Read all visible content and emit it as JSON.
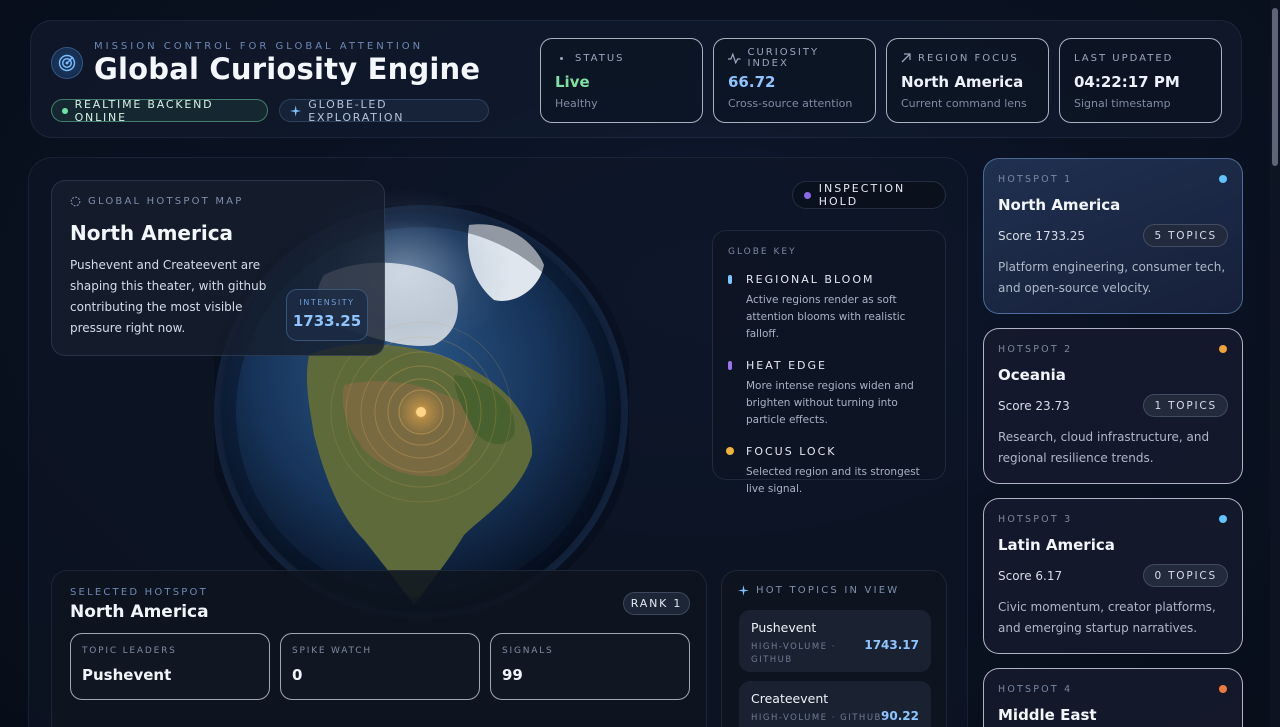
{
  "header": {
    "eyebrow": "MISSION CONTROL FOR GLOBAL ATTENTION",
    "title": "Global Curiosity Engine",
    "pill_online": "REALTIME BACKEND ONLINE",
    "pill_explore": "GLOBE-LED EXPLORATION"
  },
  "stats": [
    {
      "label": "STATUS",
      "value": "Live",
      "sub": "Healthy",
      "icon": "dot-icon",
      "value_color": "#7ee0a4"
    },
    {
      "label": "CURIOSITY INDEX",
      "value": "66.72",
      "sub": "Cross-source attention",
      "icon": "pulse-icon",
      "value_color": "#8ec4ff"
    },
    {
      "label": "REGION FOCUS",
      "value": "North America",
      "sub": "Current command lens",
      "icon": "arrow-up-right-icon",
      "value_color": "#eef3fb"
    },
    {
      "label": "LAST UPDATED",
      "value": "04:22:17 PM",
      "sub": "Signal timestamp",
      "icon": "",
      "value_color": "#eef3fb"
    }
  ],
  "map_card": {
    "eyebrow": "GLOBAL HOTSPOT MAP",
    "title": "North America",
    "description": "Pushevent and Createevent are shaping this theater, with github contributing the most visible pressure right now.",
    "intensity_label": "INTENSITY",
    "intensity_value": "1733.25"
  },
  "inspection_pill": "INSPECTION HOLD",
  "globe_key": {
    "heading": "GLOBE KEY",
    "items": [
      {
        "title": "REGIONAL BLOOM",
        "desc": "Active regions render as soft attention blooms with realistic falloff.",
        "color": "#7cc6ff"
      },
      {
        "title": "HEAT EDGE",
        "desc": "More intense regions widen and brighten without turning into particle effects.",
        "color": "#9a74f0"
      },
      {
        "title": "FOCUS LOCK",
        "desc": "Selected region and its strongest live signal.",
        "color": "#f0b43c"
      }
    ]
  },
  "selected": {
    "eyebrow": "SELECTED HOTSPOT",
    "title": "North America",
    "rank": "RANK 1",
    "metrics": [
      {
        "label": "TOPIC LEADERS",
        "value": "Pushevent"
      },
      {
        "label": "SPIKE WATCH",
        "value": "0"
      },
      {
        "label": "SIGNALS",
        "value": "99"
      }
    ]
  },
  "hot_topics": {
    "heading": "HOT TOPICS IN VIEW",
    "items": [
      {
        "name": "Pushevent",
        "meta": "HIGH-VOLUME · GITHUB",
        "score": "1743.17"
      },
      {
        "name": "Createevent",
        "meta": "HIGH-VOLUME · GITHUB",
        "score": "90.22"
      }
    ]
  },
  "hotspots": [
    {
      "eyebrow": "HOTSPOT 1",
      "title": "North America",
      "score": "Score 1733.25",
      "topics": "5 TOPICS",
      "desc": "Platform engineering, consumer tech, and open-source velocity.",
      "color": "#5fc4ff"
    },
    {
      "eyebrow": "HOTSPOT 2",
      "title": "Oceania",
      "score": "Score 23.73",
      "topics": "1 TOPICS",
      "desc": "Research, cloud infrastructure, and regional resilience trends.",
      "color": "#f0a23c"
    },
    {
      "eyebrow": "HOTSPOT 3",
      "title": "Latin America",
      "score": "Score 6.17",
      "topics": "0 TOPICS",
      "desc": "Civic momentum, creator platforms, and emerging startup narratives.",
      "color": "#5fc4ff"
    },
    {
      "eyebrow": "HOTSPOT 4",
      "title": "Middle East",
      "score": "",
      "topics": "",
      "desc": "",
      "color": "#f07a3c"
    }
  ]
}
